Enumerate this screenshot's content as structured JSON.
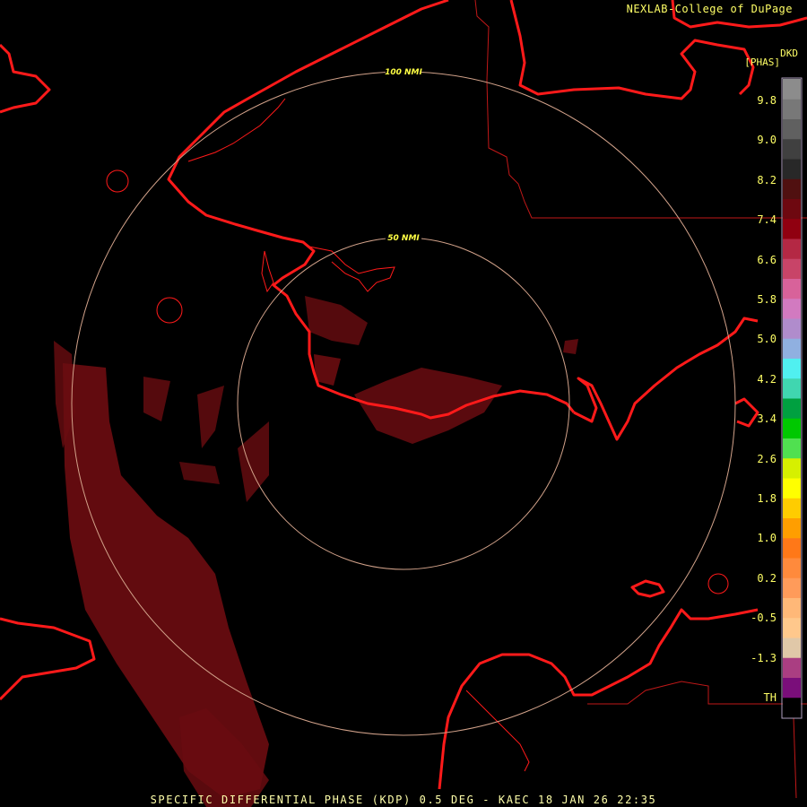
{
  "credit": "NEXLAB-College of DuPage",
  "product": "SPECIFIC DIFFERENTIAL PHASE (KDP) 0.5 DEG - KAEC 18 JAN 26 22:35",
  "units": {
    "short": "DKD",
    "long": "[PHAS]"
  },
  "range_rings": [
    {
      "label": "50 NMI",
      "nmi": 50
    },
    {
      "label": "100 NMI",
      "nmi": 100
    }
  ],
  "legend": {
    "ticks": [
      "9.8",
      "9.0",
      "8.2",
      "7.4",
      "6.6",
      "5.8",
      "5.0",
      "4.2",
      "3.4",
      "2.6",
      "1.8",
      "1.0",
      "0.2",
      "-0.5",
      "-1.3",
      "TH"
    ],
    "colors": [
      "#000000",
      "#7a0e7a",
      "#aa3e82",
      "#e0c8a8",
      "#ffc88c",
      "#ffb878",
      "#ff9b5a",
      "#ff8a3c",
      "#ff7818",
      "#ff9e00",
      "#ffcc00",
      "#ffff00",
      "#d6f000",
      "#50e050",
      "#00c800",
      "#00a040",
      "#40d6b0",
      "#50f0f0",
      "#90b0e0",
      "#b08ccc",
      "#d27ac0",
      "#d8629a",
      "#c84468",
      "#b42844",
      "#900010",
      "#6e0810",
      "#501010",
      "#282828",
      "#404040",
      "#606060",
      "#787878",
      "#8c8c8c"
    ]
  },
  "colors": {
    "coast": "#ff1a1a",
    "border": "#c01818",
    "ring": "#d2a28a",
    "echo": "#6a0c10"
  }
}
